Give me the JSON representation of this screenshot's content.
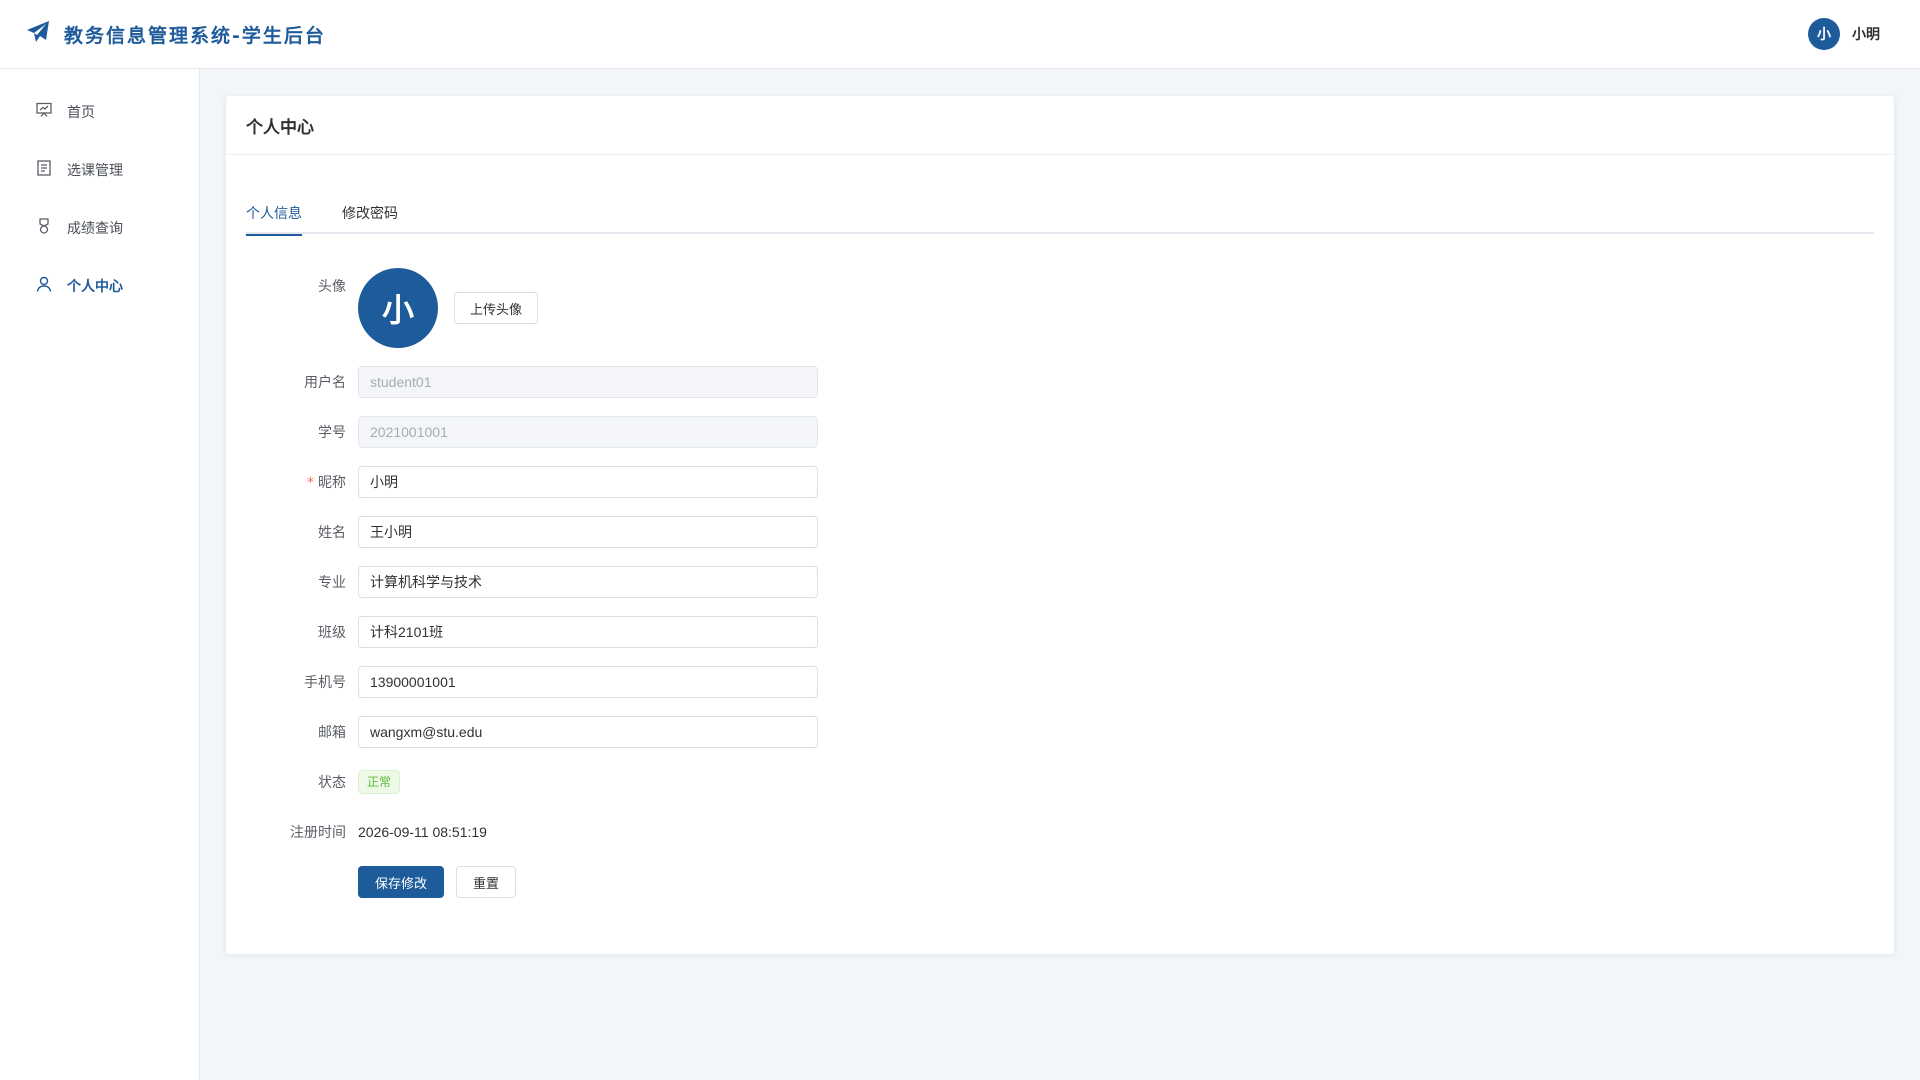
{
  "app": {
    "title": "教务信息管理系统-学生后台",
    "brand_color": "#1d5b9a"
  },
  "header": {
    "avatar_text": "小",
    "username": "小明"
  },
  "sidebar": {
    "items": [
      {
        "label": "首页",
        "icon": "presentation-chart-icon",
        "active": false
      },
      {
        "label": "选课管理",
        "icon": "document-list-icon",
        "active": false
      },
      {
        "label": "成绩查询",
        "icon": "medal-icon",
        "active": false
      },
      {
        "label": "个人中心",
        "icon": "user-icon",
        "active": true
      }
    ]
  },
  "main": {
    "card_title": "个人中心",
    "tabs": [
      {
        "label": "个人信息",
        "active": true
      },
      {
        "label": "修改密码",
        "active": false
      }
    ],
    "form": {
      "avatar_label": "头像",
      "avatar_text": "小",
      "upload_label": "上传头像",
      "fields": {
        "username": {
          "label": "用户名",
          "value": "student01",
          "disabled": true
        },
        "student_no": {
          "label": "学号",
          "value": "2021001001",
          "disabled": true
        },
        "nickname": {
          "label": "昵称",
          "value": "小明",
          "required": true
        },
        "realname": {
          "label": "姓名",
          "value": "王小明"
        },
        "major": {
          "label": "专业",
          "value": "计算机科学与技术"
        },
        "class_name": {
          "label": "班级",
          "value": "计科2101班"
        },
        "phone": {
          "label": "手机号",
          "value": "13900001001"
        },
        "email": {
          "label": "邮箱",
          "value": "wangxm@stu.edu"
        }
      },
      "status_label": "状态",
      "status_value": "正常",
      "register_label": "注册时间",
      "register_value": "2026-09-11 08:51:19",
      "save_label": "保存修改",
      "reset_label": "重置"
    }
  }
}
